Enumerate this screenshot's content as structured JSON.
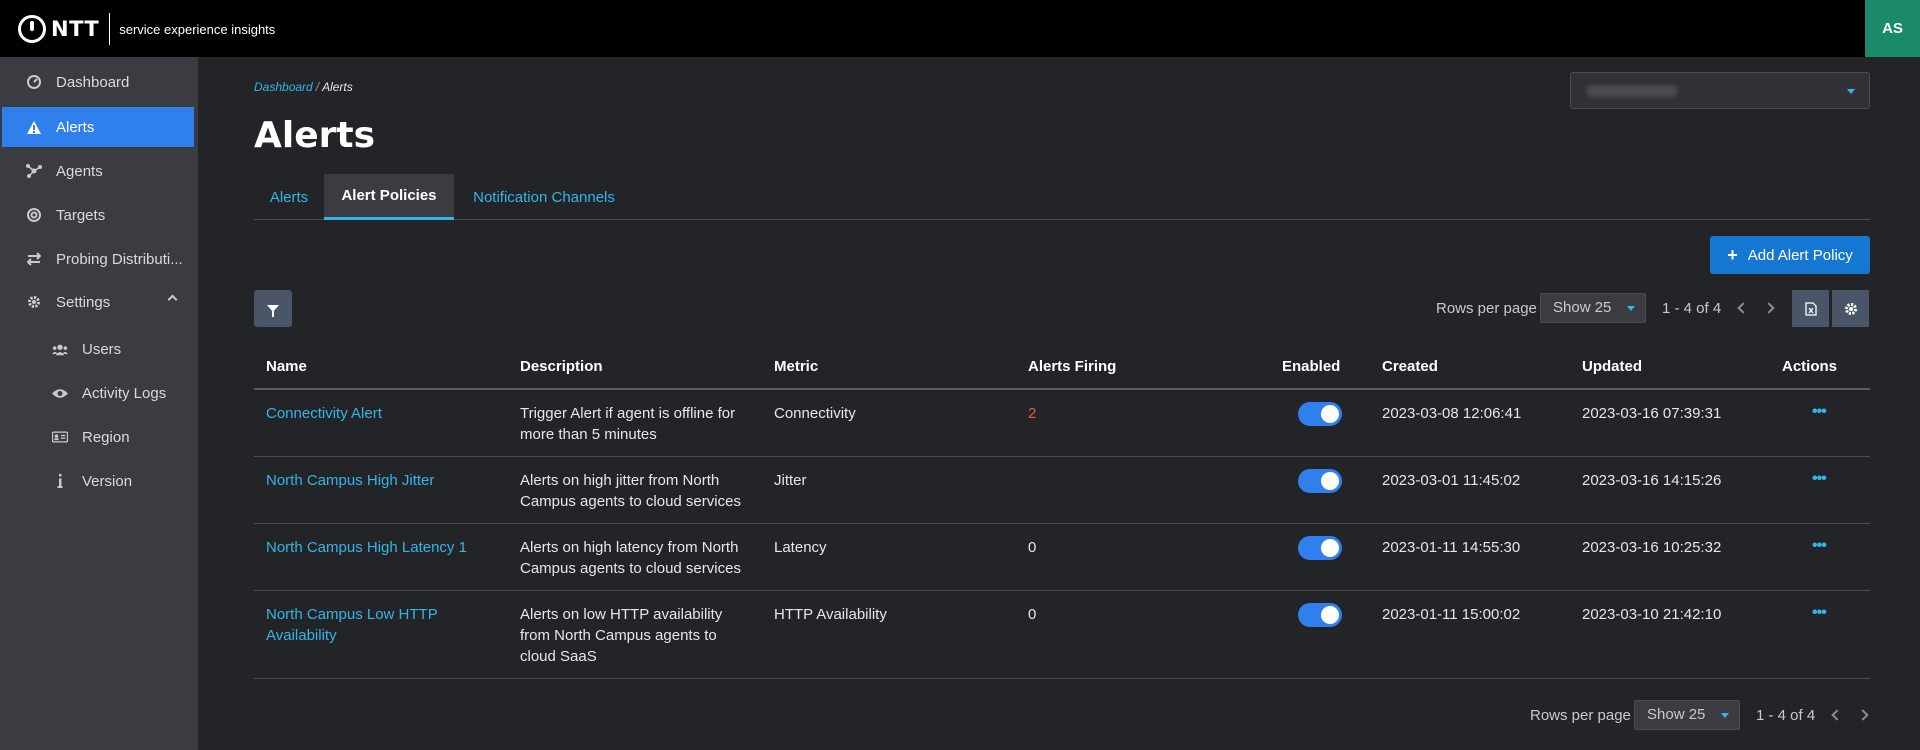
{
  "header": {
    "brand": "NTT",
    "subtitle": "service experience insights",
    "user_initials": "AS"
  },
  "sidebar": {
    "items": [
      {
        "label": "Dashboard",
        "icon": "gauge-icon"
      },
      {
        "label": "Alerts",
        "icon": "warning-icon"
      },
      {
        "label": "Agents",
        "icon": "agents-icon"
      },
      {
        "label": "Targets",
        "icon": "target-icon"
      },
      {
        "label": "Probing Distributi...",
        "icon": "arrows-exchange-icon"
      },
      {
        "label": "Settings",
        "icon": "gear-icon"
      },
      {
        "label": "Users",
        "icon": "users-icon"
      },
      {
        "label": "Activity Logs",
        "icon": "eye-icon"
      },
      {
        "label": "Region",
        "icon": "id-card-icon"
      },
      {
        "label": "Version",
        "icon": "info-icon"
      }
    ]
  },
  "breadcrumb": {
    "parent": "Dashboard",
    "separator": "/",
    "current": "Alerts"
  },
  "page": {
    "title": "Alerts"
  },
  "tabs": [
    {
      "label": "Alerts"
    },
    {
      "label": "Alert Policies"
    },
    {
      "label": "Notification Channels"
    }
  ],
  "toolbar": {
    "add_label": "Add Alert Policy",
    "add_icon": "+"
  },
  "pagination": {
    "rows_label": "Rows per page",
    "show": "Show 25",
    "range": "1 - 4 of 4"
  },
  "table": {
    "columns": [
      "Name",
      "Description",
      "Metric",
      "Alerts Firing",
      "Enabled",
      "Created",
      "Updated",
      "Actions"
    ],
    "rows": [
      {
        "name": "Connectivity Alert",
        "description": "Trigger Alert if agent is offline for more than 5 minutes",
        "metric": "Connectivity",
        "alerts_firing": "2",
        "enabled": true,
        "created": "2023-03-08 12:06:41",
        "updated": "2023-03-16 07:39:31",
        "actions": "•••"
      },
      {
        "name": "North Campus High Jitter",
        "description": "Alerts on high jitter from North Campus agents to cloud services",
        "metric": "Jitter",
        "alerts_firing": "",
        "enabled": true,
        "created": "2023-03-01 11:45:02",
        "updated": "2023-03-16 14:15:26",
        "actions": "•••"
      },
      {
        "name": "North Campus High Latency 1",
        "description": "Alerts on high latency from North Campus agents to cloud services",
        "metric": "Latency",
        "alerts_firing": "0",
        "enabled": true,
        "created": "2023-01-11 14:55:30",
        "updated": "2023-03-16 10:25:32",
        "actions": "•••"
      },
      {
        "name": "North Campus Low HTTP Availability",
        "description": "Alerts on low HTTP availability from North Campus agents to cloud SaaS",
        "metric": "HTTP Availability",
        "alerts_firing": "0",
        "enabled": true,
        "created": "2023-01-11 15:00:02",
        "updated": "2023-03-10 21:42:10",
        "actions": "•••"
      }
    ]
  },
  "colors": {
    "accent": "#33b5e5",
    "primary": "#2f80ed",
    "avatar": "#1b8a6b",
    "alert_red": "#e05a4e"
  }
}
